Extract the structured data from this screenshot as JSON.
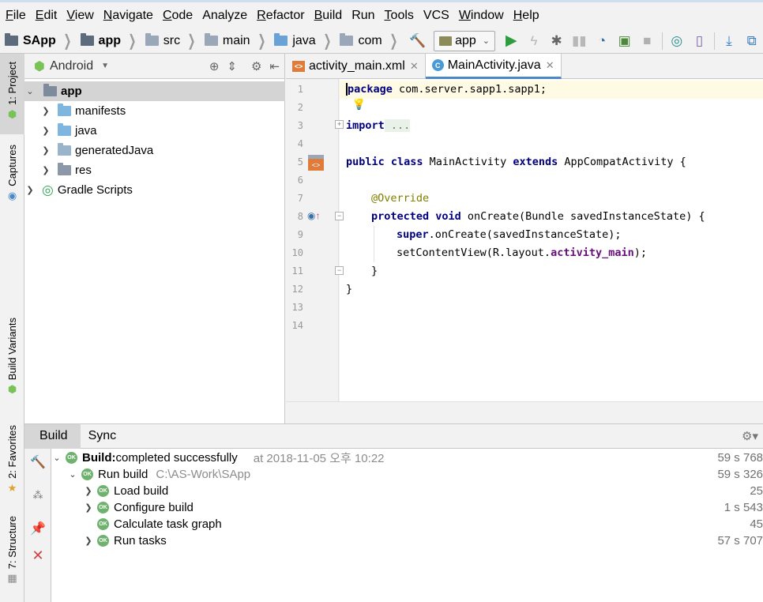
{
  "menu": [
    {
      "label": "File",
      "mnemonic": "F",
      "rest": "ile"
    },
    {
      "label": "Edit",
      "mnemonic": "E",
      "rest": "dit"
    },
    {
      "label": "View",
      "mnemonic": "V",
      "rest": "iew"
    },
    {
      "label": "Navigate",
      "mnemonic": "N",
      "rest": "avigate"
    },
    {
      "label": "Code",
      "mnemonic": "C",
      "rest": "ode"
    },
    {
      "label": "Analyze",
      "mnemonic": "",
      "rest": "Analyze"
    },
    {
      "label": "Refactor",
      "mnemonic": "R",
      "rest": "efactor"
    },
    {
      "label": "Build",
      "mnemonic": "B",
      "rest": "uild"
    },
    {
      "label": "Run",
      "mnemonic": "",
      "rest": "Run"
    },
    {
      "label": "Tools",
      "mnemonic": "T",
      "rest": "ools"
    },
    {
      "label": "VCS",
      "mnemonic": "",
      "rest": "VCS"
    },
    {
      "label": "Window",
      "mnemonic": "W",
      "rest": "indow"
    },
    {
      "label": "Help",
      "mnemonic": "H",
      "rest": "elp"
    }
  ],
  "breadcrumbs": [
    "SApp",
    "app",
    "src",
    "main",
    "java",
    "com"
  ],
  "run_config": "app",
  "left_tabs": {
    "project": "1: Project",
    "captures": "Captures",
    "build_variants": "Build Variants",
    "favorites": "2: Favorites",
    "structure": "7: Structure"
  },
  "project_panel": {
    "view_mode": "Android",
    "tree": [
      {
        "label": "app",
        "expanded": true,
        "bold": true
      },
      {
        "label": "manifests"
      },
      {
        "label": "java"
      },
      {
        "label": "generatedJava"
      },
      {
        "label": "res"
      },
      {
        "label": "Gradle Scripts"
      }
    ]
  },
  "editor": {
    "tabs": [
      {
        "label": "activity_main.xml",
        "icon": "xml-file-icon"
      },
      {
        "label": "MainActivity.java",
        "icon": "class-c-icon"
      }
    ],
    "line_numbers": [
      "1",
      "2",
      "3",
      "4",
      "5",
      "6",
      "7",
      "8",
      "9",
      "10",
      "11",
      "12",
      "13",
      "14"
    ],
    "code": {
      "l1_kw": "package",
      "l1_rest": " com.server.sapp1.sapp1;",
      "l3_kw": "import",
      "l3_fold": " ...",
      "l6_kw1": "public class",
      "l6_name": " MainActivity ",
      "l6_kw2": "extends",
      "l6_rest": " AppCompatActivity {",
      "l8_ann": "@Override",
      "l9_kw": "protected void",
      "l9_rest": " onCreate(Bundle savedInstanceState) {",
      "l10_kw": "super",
      "l10_rest": ".onCreate(savedInstanceState);",
      "l11_pre": "setContentView(R.layout.",
      "l11_fld": "activity_main",
      "l11_post": ");",
      "l12": "}",
      "l13": "}"
    }
  },
  "build_panel": {
    "tabs": [
      "Build",
      "Sync"
    ],
    "rows": [
      {
        "label_bold": "Build:",
        "label": " completed successfully",
        "meta": "at 2018-11-05 오후 10:22",
        "time": "59 s 768"
      },
      {
        "label": "Run build",
        "meta": "C:\\AS-Work\\SApp",
        "time": "59 s 326"
      },
      {
        "label": "Load build",
        "time": "25"
      },
      {
        "label": "Configure build",
        "time": "1 s 543"
      },
      {
        "label": "Calculate task graph",
        "time": "45"
      },
      {
        "label": "Run tasks",
        "time": "57 s 707"
      }
    ]
  },
  "colors": {
    "accent_tab": "#4a88c7",
    "ok_badge": "#6eb26e",
    "keyword": "#000080",
    "annotation": "#808000",
    "field": "#660e7a",
    "android_green": "#78c257"
  }
}
